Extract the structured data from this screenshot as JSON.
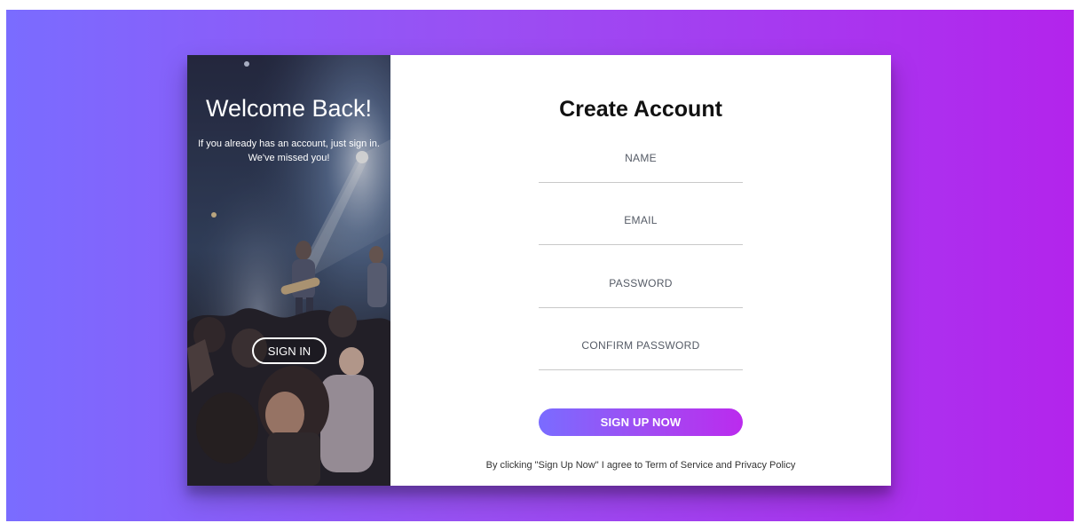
{
  "welcome_panel": {
    "title": "Welcome Back!",
    "message": "If you already has an account, just sign in. We've missed you!",
    "signin_label": "SIGN IN",
    "image": "concert-crowd-photo"
  },
  "signup_form": {
    "title": "Create Account",
    "name_placeholder": "NAME",
    "email_placeholder": "EMAIL",
    "password_placeholder": "PASSWORD",
    "confirm_password_placeholder": "CONFIRM PASSWORD",
    "submit_label": "SIGN UP NOW",
    "terms": "By clicking \"Sign Up Now\" I agree to Term of Service and Privacy Policy"
  },
  "colors": {
    "gradient_start": "#7a6cff",
    "gradient_end": "#b324ec",
    "card_background": "#ffffff"
  }
}
